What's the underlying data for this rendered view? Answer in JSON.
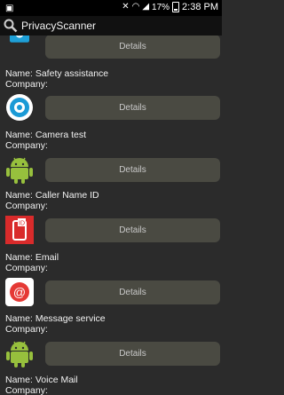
{
  "status_bar": {
    "battery": "17%",
    "time": "2:38 PM"
  },
  "action_bar": {
    "title": "PrivacyScanner"
  },
  "list": {
    "details_label": "Details",
    "items": [
      {
        "name": "Name: Safety assistance",
        "company": "Company:",
        "icon": "microphone-icon"
      },
      {
        "name": "Name: Camera test",
        "company": "Company:",
        "icon": "gear-icon"
      },
      {
        "name": "Name: Caller Name ID",
        "company": "Company:",
        "icon": "android-icon"
      },
      {
        "name": "Name: Email",
        "company": "Company:",
        "icon": "caller-id-icon"
      },
      {
        "name": "Name: Message service",
        "company": "Company:",
        "icon": "email-icon"
      },
      {
        "name": "Name: Voice Mail",
        "company": "Company:",
        "icon": "android-icon"
      }
    ]
  }
}
